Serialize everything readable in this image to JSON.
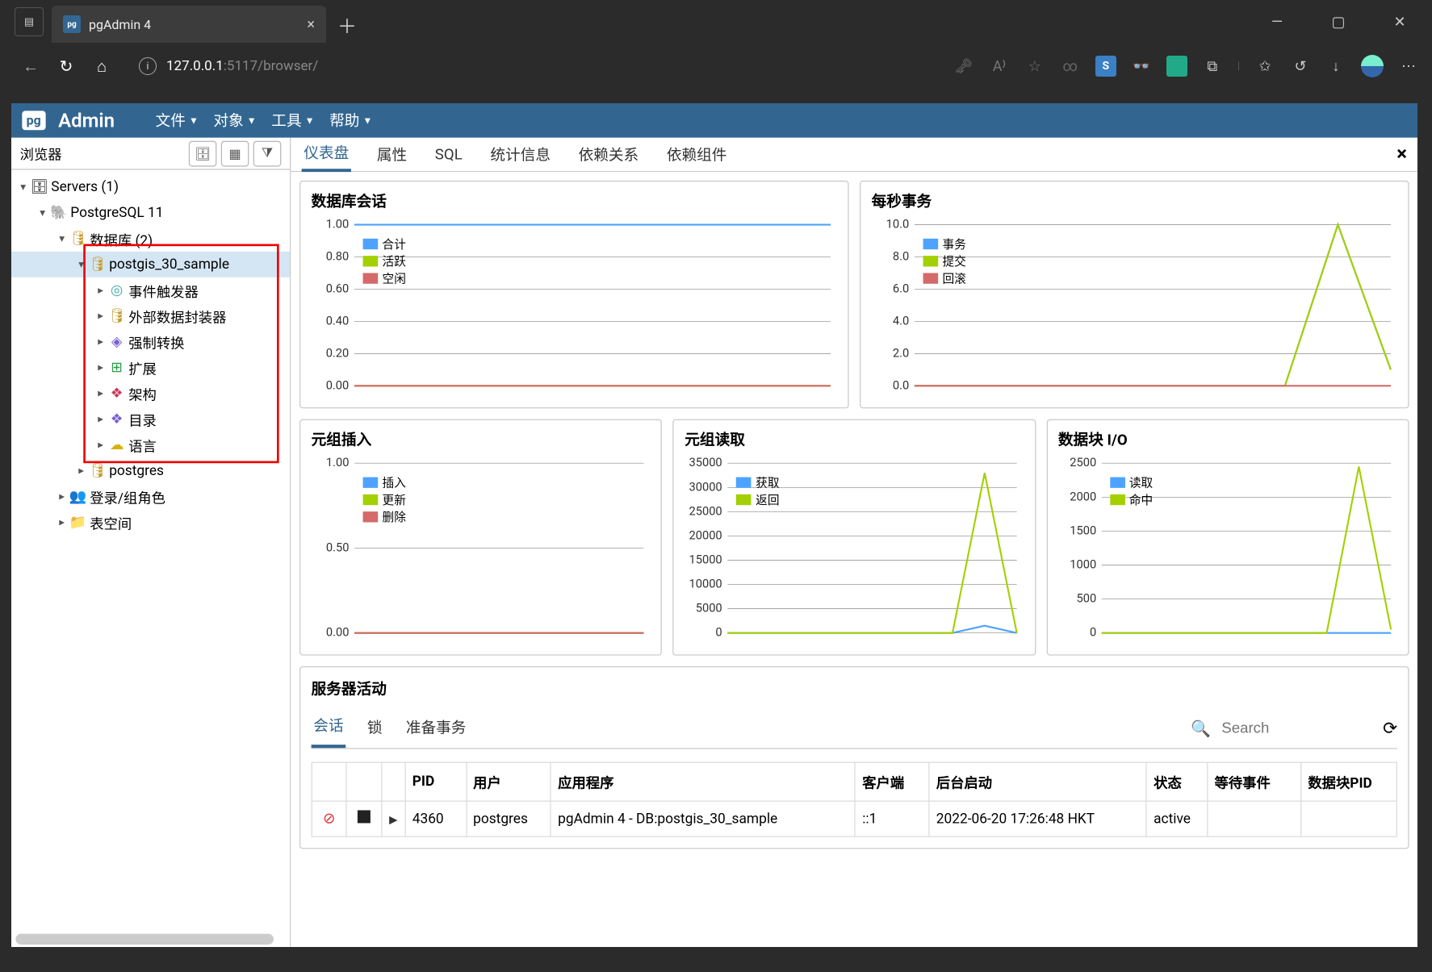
{
  "browser": {
    "tab_title": "pgAdmin 4",
    "url_host": "127.0.0.1",
    "url_path": ":5117/browser/"
  },
  "pga": {
    "logo_pg": "pg",
    "logo_admin": "Admin",
    "menus": [
      "文件",
      "对象",
      "工具",
      "帮助"
    ]
  },
  "sidebar": {
    "title": "浏览器",
    "tree": {
      "servers": "Servers (1)",
      "pg11": "PostgreSQL 11",
      "databases": "数据库 (2)",
      "db_sample": "postgis_30_sample",
      "children": [
        "事件触发器",
        "外部数据封装器",
        "强制转换",
        "扩展",
        "架构",
        "目录",
        "语言"
      ],
      "db_postgres": "postgres",
      "login": "登录/组角色",
      "tablespace": "表空间"
    }
  },
  "tabs": [
    "仪表盘",
    "属性",
    "SQL",
    "统计信息",
    "依赖关系",
    "依赖组件"
  ],
  "cards": {
    "sessions": {
      "title": "数据库会话",
      "legend": [
        "合计",
        "活跃",
        "空闲"
      ],
      "colors": [
        "#4da3ff",
        "#a4d000",
        "#d46a6a"
      ]
    },
    "tps": {
      "title": "每秒事务",
      "legend": [
        "事务",
        "提交",
        "回滚"
      ],
      "colors": [
        "#4da3ff",
        "#a4d000",
        "#d46a6a"
      ]
    },
    "ti": {
      "title": "元组插入",
      "legend": [
        "插入",
        "更新",
        "删除"
      ],
      "colors": [
        "#4da3ff",
        "#a4d000",
        "#d46a6a"
      ]
    },
    "to": {
      "title": "元组读取",
      "legend": [
        "获取",
        "返回"
      ],
      "colors": [
        "#4da3ff",
        "#a4d000"
      ]
    },
    "bio": {
      "title": "数据块 I/O",
      "legend": [
        "读取",
        "命中"
      ],
      "colors": [
        "#4da3ff",
        "#a4d000"
      ]
    }
  },
  "chart_data": [
    {
      "type": "line",
      "title": "数据库会话",
      "ylim": [
        0,
        1.0
      ],
      "yticks": [
        0.0,
        0.2,
        0.4,
        0.6,
        0.8,
        1.0
      ],
      "series": [
        {
          "name": "合计",
          "values": [
            1,
            1,
            1,
            1,
            1,
            1,
            1,
            1,
            1,
            1
          ]
        },
        {
          "name": "活跃",
          "values": [
            0,
            0,
            0,
            0,
            0,
            0,
            0,
            0,
            0,
            0
          ]
        },
        {
          "name": "空闲",
          "values": [
            0,
            0,
            0,
            0,
            0,
            0,
            0,
            0,
            0,
            0
          ]
        }
      ]
    },
    {
      "type": "line",
      "title": "每秒事务",
      "ylim": [
        0,
        10
      ],
      "yticks": [
        0.0,
        2.0,
        4.0,
        6.0,
        8.0,
        10.0
      ],
      "series": [
        {
          "name": "事务",
          "values": [
            0,
            0,
            0,
            0,
            0,
            0,
            0,
            0,
            10,
            1
          ]
        },
        {
          "name": "提交",
          "values": [
            0,
            0,
            0,
            0,
            0,
            0,
            0,
            0,
            10,
            1
          ]
        },
        {
          "name": "回滚",
          "values": [
            0,
            0,
            0,
            0,
            0,
            0,
            0,
            0,
            0,
            0
          ]
        }
      ]
    },
    {
      "type": "line",
      "title": "元组插入",
      "ylim": [
        0,
        1.0
      ],
      "yticks": [
        0.0,
        0.5,
        1.0
      ],
      "series": [
        {
          "name": "插入",
          "values": [
            0,
            0,
            0,
            0,
            0,
            0,
            0,
            0,
            0,
            0
          ]
        },
        {
          "name": "更新",
          "values": [
            0,
            0,
            0,
            0,
            0,
            0,
            0,
            0,
            0,
            0
          ]
        },
        {
          "name": "删除",
          "values": [
            0,
            0,
            0,
            0,
            0,
            0,
            0,
            0,
            0,
            0
          ]
        }
      ]
    },
    {
      "type": "line",
      "title": "元组读取",
      "ylim": [
        0,
        35000
      ],
      "yticks": [
        0,
        5000,
        10000,
        15000,
        20000,
        25000,
        30000,
        35000
      ],
      "series": [
        {
          "name": "获取",
          "values": [
            0,
            0,
            0,
            0,
            0,
            0,
            0,
            0,
            1500,
            0
          ]
        },
        {
          "name": "返回",
          "values": [
            0,
            0,
            0,
            0,
            0,
            0,
            0,
            0,
            33000,
            0
          ]
        }
      ]
    },
    {
      "type": "line",
      "title": "数据块 I/O",
      "ylim": [
        0,
        2500
      ],
      "yticks": [
        0,
        500,
        1000,
        1500,
        2000,
        2500
      ],
      "series": [
        {
          "name": "读取",
          "values": [
            0,
            0,
            0,
            0,
            0,
            0,
            0,
            0,
            0,
            0
          ]
        },
        {
          "name": "命中",
          "values": [
            0,
            0,
            0,
            0,
            0,
            0,
            0,
            0,
            2450,
            50
          ]
        }
      ]
    }
  ],
  "activity": {
    "title": "服务器活动",
    "tabs": [
      "会话",
      "锁",
      "准备事务"
    ],
    "search_placeholder": "Search",
    "columns": [
      "PID",
      "用户",
      "应用程序",
      "客户端",
      "后台启动",
      "状态",
      "等待事件",
      "数据块PID"
    ],
    "rows": [
      {
        "pid": "4360",
        "user": "postgres",
        "app": "pgAdmin 4 - DB:postgis_30_sample",
        "client": "::1",
        "start": "2022-06-20 17:26:48 HKT",
        "state": "active",
        "wait": "",
        "block": ""
      }
    ]
  }
}
